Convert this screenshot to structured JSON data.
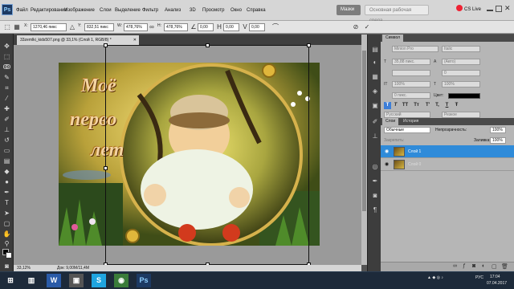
{
  "app": {
    "logo": "Ps"
  },
  "menu": [
    "Файл",
    "Редактирование",
    "Изображение",
    "Слои",
    "Выделение",
    "Фильтр",
    "Анализ",
    "3D",
    "Просмотр",
    "Окно",
    "Справка"
  ],
  "workspace": {
    "mode_active": "Мазки",
    "mode_search": "Основная рабочая среда",
    "cs_live": "CS Live"
  },
  "options": {
    "x": "1270,46 пикс",
    "y": "832,51 пикс",
    "w": "478,76%",
    "h": "478,76%",
    "angle": "0,00",
    "hskew": "0,00",
    "vskew": "0,00",
    "labels": {
      "x": "X:",
      "y": "Y:",
      "w": "W:",
      "h": "H:"
    }
  },
  "document": {
    "tab_title": "33zemlki_kids507.png @ 33,1% (Слой 1, RGB/8) *",
    "canvas_text": [
      "Моё",
      "перво",
      "лет"
    ]
  },
  "status": {
    "zoom": "33,12%",
    "doc_size": "Док: 9,00M/11,4M"
  },
  "character": {
    "tab": "Символ",
    "font_family": "Minion Pro",
    "font_style": "Italic",
    "size": "35,88 пикс.",
    "leading": "(Авто)",
    "kerning": "0",
    "vscale": "100%",
    "hscale": "100%",
    "baseline": "0 пикс.",
    "color_label": "Цвет:",
    "language": "Русский",
    "aa": "Резкое",
    "aa_label": "aa",
    "type_buttons": [
      "T",
      "T",
      "TT",
      "Tт",
      "T'",
      "T,",
      "T",
      "Ŧ"
    ]
  },
  "layers": {
    "tabs": [
      "Слои",
      "История"
    ],
    "blend": "Обычные",
    "opacity_label": "Непрозрачность:",
    "opacity": "100%",
    "lock_label": "Закрепить:",
    "fill_label": "Заливка:",
    "fill": "100%",
    "items": [
      {
        "name": "Слой 1",
        "selected": true
      },
      {
        "name": "Слой 0",
        "selected": false
      }
    ]
  },
  "taskbar": {
    "lang": "РУС",
    "time": "17:04",
    "date": "07.04.2017"
  }
}
